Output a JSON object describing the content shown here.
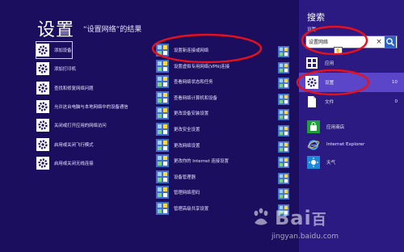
{
  "results": {
    "title": "设置",
    "subtitle": "“设置网络”的结果",
    "col1": [
      {
        "label": "添加设备"
      },
      {
        "label": "添加打印机"
      },
      {
        "label": "查找和修复网络问题"
      },
      {
        "label": "允许这台电脑与本地网络中的设备通信"
      },
      {
        "label": "关闭或打开应用的网络访问"
      },
      {
        "label": "启用或关闭飞行模式"
      },
      {
        "label": "启用或关闭无线连接"
      }
    ],
    "col2": [
      {
        "label": "设置新连接或网络"
      },
      {
        "label": "设置虚拟专用网络(VPN)连接"
      },
      {
        "label": "查看网络状态和任务"
      },
      {
        "label": "查看网络计算机和设备"
      },
      {
        "label": "更改设备安装设置"
      },
      {
        "label": "更改安全设置"
      },
      {
        "label": "更改网络设置"
      },
      {
        "label": "更改你的 Internet 连接设置"
      },
      {
        "label": "设备管理器"
      },
      {
        "label": "管理网络密码"
      },
      {
        "label": "管理高级共享设置"
      }
    ],
    "col3_count": 11
  },
  "search_pane": {
    "title": "搜索",
    "scope_label": "设置",
    "query": "设置网络",
    "clear_glyph": "×",
    "categories": [
      {
        "label": "应用",
        "count": "",
        "icon": "apps-icon"
      },
      {
        "label": "设置",
        "count": "10",
        "icon": "gear-icon"
      },
      {
        "label": "文件",
        "count": "0",
        "icon": "file-icon"
      }
    ],
    "apps": [
      {
        "label": "应用商店",
        "icon": "store-icon"
      },
      {
        "label": "Internet Explorer",
        "icon": "internet-explorer-icon"
      },
      {
        "label": "天气",
        "icon": "weather-icon"
      }
    ]
  },
  "watermark": {
    "brand": "Bai",
    "brand2": "百",
    "site": "jingyan.baidu.com"
  },
  "colors": {
    "background": "#1d0f5f",
    "pane": "#2a1a82",
    "highlight": "#5b46c9",
    "annotation": "#e8101a"
  }
}
